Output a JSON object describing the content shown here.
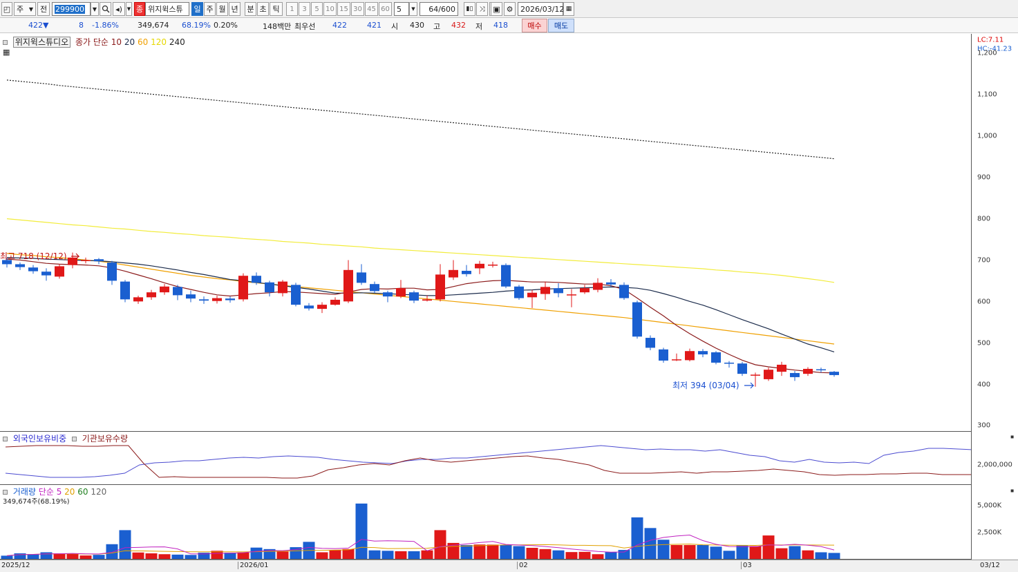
{
  "toolbar": {
    "period_select": "주",
    "prefix_btn": "전",
    "stock_code": "299900",
    "jong_badge": "종",
    "stock_name": "위지윅스튜",
    "periods": [
      "일",
      "주",
      "월",
      "년",
      "분",
      "초",
      "틱"
    ],
    "minute_options": [
      "1",
      "3",
      "5",
      "10",
      "15",
      "30",
      "45",
      "60"
    ],
    "interval_value": "5",
    "count_display": "64/600",
    "date": "2026/03/12"
  },
  "quote": {
    "price": "422",
    "change_arrow": "▼",
    "change": "8",
    "change_pct": "-1.86%",
    "volume": "349,674",
    "volume_ratio": "68.19%",
    "turnover": "0.20%",
    "amount": "148백만",
    "best_ask_label": "최우선",
    "best_ask": "422",
    "best_bid": "421",
    "open_label": "시",
    "open": "430",
    "high_label": "고",
    "high": "432",
    "low_label": "저",
    "low": "418",
    "buy_label": "매수",
    "sell_label": "매도"
  },
  "price_panel": {
    "stock_label": "위지윅스튜디오",
    "legend_prefix": "종가 단순",
    "ma_labels": [
      "10",
      "20",
      "60",
      "120",
      "240"
    ],
    "lc_label": "LC:7.11",
    "hc_label": "HC:-41.23",
    "high_annotation": "최고 718 (12/12)",
    "low_annotation": "최저 394 (03/04)",
    "y_ticks": [
      "1,200",
      "1,100",
      "1,000",
      "900",
      "800",
      "700",
      "600",
      "500",
      "400",
      "300"
    ]
  },
  "holding_panel": {
    "label1": "외국인보유비중",
    "label2": "기관보유수량",
    "y_tick": "2,000,000"
  },
  "volume_panel": {
    "label": "거래량",
    "legend_prefix": "단순",
    "ma_labels": [
      "5",
      "20",
      "60",
      "120"
    ],
    "current": "349,674주(68.19%)",
    "y_ticks": [
      "5,000K",
      "2,500K"
    ]
  },
  "date_axis": {
    "labels": [
      "2025/12",
      "2026/01",
      "02",
      "03"
    ],
    "current": "03/12"
  },
  "colors": {
    "up": "#e01818",
    "down": "#1a5fd0",
    "ma10": "#8b1a1a",
    "ma20": "#1a2a4a",
    "ma60": "#f0a000",
    "ma120": "#f2ec3a",
    "ma240": "#222222"
  },
  "chart_data": {
    "type": "candlestick",
    "ylim": [
      290,
      1230
    ],
    "candles": [
      {
        "o": 700,
        "c": 690,
        "h": 705,
        "l": 682
      },
      {
        "o": 690,
        "c": 683,
        "h": 694,
        "l": 676
      },
      {
        "o": 682,
        "c": 673,
        "h": 688,
        "l": 667
      },
      {
        "o": 672,
        "c": 663,
        "h": 680,
        "l": 650
      },
      {
        "o": 660,
        "c": 685,
        "h": 690,
        "l": 655
      },
      {
        "o": 688,
        "c": 706,
        "h": 718,
        "l": 680
      },
      {
        "o": 700,
        "c": 700,
        "h": 706,
        "l": 692
      },
      {
        "o": 702,
        "c": 697,
        "h": 705,
        "l": 690
      },
      {
        "o": 694,
        "c": 650,
        "h": 698,
        "l": 640
      },
      {
        "o": 648,
        "c": 605,
        "h": 652,
        "l": 598
      },
      {
        "o": 600,
        "c": 610,
        "h": 614,
        "l": 594
      },
      {
        "o": 610,
        "c": 622,
        "h": 628,
        "l": 604
      },
      {
        "o": 622,
        "c": 636,
        "h": 642,
        "l": 616
      },
      {
        "o": 635,
        "c": 615,
        "h": 640,
        "l": 603
      },
      {
        "o": 617,
        "c": 607,
        "h": 626,
        "l": 598
      },
      {
        "o": 605,
        "c": 602,
        "h": 612,
        "l": 594
      },
      {
        "o": 601,
        "c": 608,
        "h": 614,
        "l": 595
      },
      {
        "o": 607,
        "c": 603,
        "h": 612,
        "l": 597
      },
      {
        "o": 605,
        "c": 662,
        "h": 668,
        "l": 600
      },
      {
        "o": 662,
        "c": 645,
        "h": 670,
        "l": 640
      },
      {
        "o": 646,
        "c": 622,
        "h": 650,
        "l": 612
      },
      {
        "o": 620,
        "c": 648,
        "h": 652,
        "l": 612
      },
      {
        "o": 640,
        "c": 592,
        "h": 645,
        "l": 588
      },
      {
        "o": 590,
        "c": 583,
        "h": 596,
        "l": 578
      },
      {
        "o": 582,
        "c": 592,
        "h": 598,
        "l": 572
      },
      {
        "o": 592,
        "c": 604,
        "h": 610,
        "l": 590
      },
      {
        "o": 600,
        "c": 676,
        "h": 700,
        "l": 596
      },
      {
        "o": 670,
        "c": 645,
        "h": 690,
        "l": 640
      },
      {
        "o": 642,
        "c": 625,
        "h": 648,
        "l": 620
      },
      {
        "o": 622,
        "c": 612,
        "h": 626,
        "l": 598
      },
      {
        "o": 612,
        "c": 632,
        "h": 652,
        "l": 608
      },
      {
        "o": 622,
        "c": 602,
        "h": 626,
        "l": 596
      },
      {
        "o": 602,
        "c": 605,
        "h": 615,
        "l": 600
      },
      {
        "o": 605,
        "c": 665,
        "h": 690,
        "l": 600
      },
      {
        "o": 658,
        "c": 676,
        "h": 700,
        "l": 652
      },
      {
        "o": 674,
        "c": 666,
        "h": 688,
        "l": 660
      },
      {
        "o": 680,
        "c": 691,
        "h": 698,
        "l": 666
      },
      {
        "o": 689,
        "c": 689,
        "h": 696,
        "l": 682
      },
      {
        "o": 688,
        "c": 636,
        "h": 692,
        "l": 632
      },
      {
        "o": 636,
        "c": 608,
        "h": 640,
        "l": 604
      },
      {
        "o": 610,
        "c": 621,
        "h": 628,
        "l": 584
      },
      {
        "o": 618,
        "c": 635,
        "h": 648,
        "l": 604
      },
      {
        "o": 632,
        "c": 620,
        "h": 644,
        "l": 610
      },
      {
        "o": 615,
        "c": 617,
        "h": 630,
        "l": 586
      },
      {
        "o": 622,
        "c": 632,
        "h": 640,
        "l": 618
      },
      {
        "o": 628,
        "c": 645,
        "h": 656,
        "l": 622
      },
      {
        "o": 646,
        "c": 641,
        "h": 654,
        "l": 636
      },
      {
        "o": 640,
        "c": 608,
        "h": 646,
        "l": 604
      },
      {
        "o": 598,
        "c": 515,
        "h": 602,
        "l": 510
      },
      {
        "o": 512,
        "c": 488,
        "h": 518,
        "l": 482
      },
      {
        "o": 484,
        "c": 457,
        "h": 488,
        "l": 452
      },
      {
        "o": 460,
        "c": 460,
        "h": 474,
        "l": 456
      },
      {
        "o": 458,
        "c": 480,
        "h": 486,
        "l": 455
      },
      {
        "o": 480,
        "c": 472,
        "h": 485,
        "l": 465
      },
      {
        "o": 477,
        "c": 452,
        "h": 480,
        "l": 448
      },
      {
        "o": 452,
        "c": 450,
        "h": 456,
        "l": 440
      },
      {
        "o": 450,
        "c": 425,
        "h": 454,
        "l": 420
      },
      {
        "o": 423,
        "c": 423,
        "h": 428,
        "l": 394
      },
      {
        "o": 412,
        "c": 435,
        "h": 440,
        "l": 408
      },
      {
        "o": 430,
        "c": 447,
        "h": 454,
        "l": 420
      },
      {
        "o": 427,
        "c": 417,
        "h": 432,
        "l": 408
      },
      {
        "o": 425,
        "c": 437,
        "h": 441,
        "l": 420
      },
      {
        "o": 436,
        "c": 434,
        "h": 440,
        "l": 428
      },
      {
        "o": 430,
        "c": 422,
        "h": 432,
        "l": 418
      }
    ],
    "ma10": [
      702,
      700,
      696,
      692,
      690,
      689,
      688,
      686,
      681,
      673,
      664,
      655,
      645,
      636,
      629,
      622,
      616,
      613,
      616,
      619,
      621,
      624,
      623,
      621,
      619,
      617,
      623,
      629,
      631,
      630,
      632,
      632,
      628,
      629,
      636,
      643,
      647,
      650,
      651,
      649,
      647,
      647,
      646,
      644,
      642,
      642,
      638,
      629,
      608,
      586,
      565,
      542,
      522,
      504,
      487,
      472,
      458,
      447,
      442,
      438,
      434,
      431,
      428,
      427
    ],
    "ma20": [
      706,
      705,
      704,
      702,
      701,
      700,
      699,
      698,
      696,
      693,
      690,
      686,
      681,
      676,
      670,
      665,
      659,
      653,
      650,
      646,
      642,
      638,
      634,
      630,
      625,
      620,
      620,
      621,
      620,
      619,
      617,
      616,
      614,
      614,
      616,
      618,
      620,
      622,
      625,
      627,
      628,
      630,
      631,
      632,
      633,
      634,
      635,
      634,
      632,
      627,
      619,
      610,
      600,
      591,
      580,
      568,
      556,
      545,
      534,
      521,
      509,
      497,
      488,
      478
    ],
    "ma60": [
      716,
      713,
      711,
      708,
      706,
      703,
      700,
      697,
      693,
      688,
      683,
      678,
      673,
      668,
      663,
      659,
      655,
      652,
      648,
      645,
      642,
      639,
      636,
      633,
      630,
      627,
      624,
      621,
      618,
      615,
      612,
      609,
      606,
      603,
      600,
      597,
      594,
      591,
      588,
      585,
      582,
      579,
      576,
      573,
      570,
      567,
      564,
      561,
      557,
      553,
      549,
      545,
      541,
      537,
      533,
      529,
      525,
      521,
      517,
      513,
      509,
      505,
      501,
      497
    ],
    "ma120": [
      800,
      797,
      794,
      791,
      788,
      785,
      783,
      780,
      777,
      775,
      772,
      769,
      767,
      764,
      762,
      759,
      757,
      755,
      752,
      750,
      748,
      745,
      743,
      741,
      738,
      736,
      734,
      732,
      729,
      727,
      725,
      723,
      721,
      719,
      717,
      715,
      713,
      711,
      709,
      707,
      705,
      703,
      701,
      699,
      697,
      695,
      693,
      691,
      689,
      687,
      685,
      683,
      681,
      679,
      676,
      674,
      671,
      669,
      666,
      663,
      659,
      655,
      651,
      646
    ],
    "ma240": [
      1135,
      1132,
      1129,
      1126,
      1122,
      1119,
      1116,
      1113,
      1110,
      1107,
      1104,
      1101,
      1098,
      1095,
      1092,
      1089,
      1086,
      1083,
      1080,
      1077,
      1074,
      1071,
      1068,
      1065,
      1062,
      1059,
      1056,
      1053,
      1050,
      1047,
      1044,
      1041,
      1038,
      1035,
      1032,
      1029,
      1026,
      1023,
      1020,
      1017,
      1014,
      1011,
      1008,
      1005,
      1002,
      999,
      996,
      993,
      990,
      987,
      984,
      981,
      978,
      975,
      972,
      969,
      966,
      963,
      960,
      957,
      954,
      951,
      948,
      945
    ]
  }
}
